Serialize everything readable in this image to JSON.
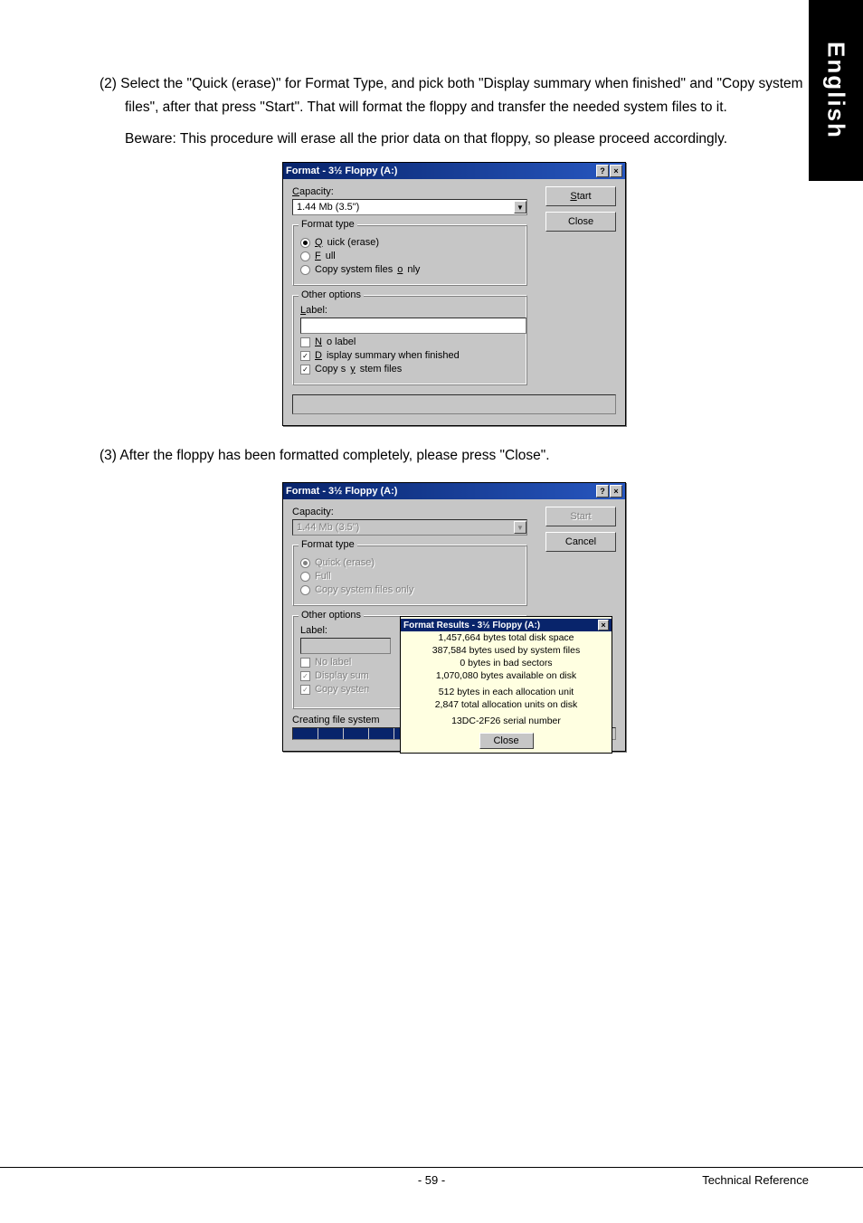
{
  "side_tab": "English",
  "step2": "(2)  Select the \"Quick (erase)\" for Format Type, and pick both \"Display summary when finished\" and \"Copy system files\", after that press \"Start\".  That will format the floppy and transfer the needed system files to it.",
  "step2_note": "Beware: This procedure will erase all the prior data on that floppy, so please proceed accordingly.",
  "step3": "(3)  After the floppy has been formatted completely, please press \"Close\".",
  "dlg1": {
    "title": "Format - 3½ Floppy (A:)",
    "capacity_lbl": "Capacity:",
    "capacity_val": "1.44 Mb (3.5\")",
    "start": "Start",
    "close": "Close",
    "ftype_legend": "Format type",
    "r1": "Quick (erase)",
    "r2": "Full",
    "r3": "Copy system files only",
    "other_legend": "Other options",
    "label_lbl": "Label:",
    "c1": "No label",
    "c2": "Display summary when finished",
    "c3": "Copy system files"
  },
  "dlg2": {
    "title": "Format - 3½ Floppy (A:)",
    "capacity_lbl": "Capacity:",
    "capacity_val": "1.44 Mb (3.5\")",
    "start": "Start",
    "cancel": "Cancel",
    "ftype_legend": "Format type",
    "r1": "Quick (erase)",
    "r2": "Full",
    "r3": "Copy system files only",
    "other_legend": "Other options",
    "label_lbl": "Label:",
    "c1": "No label",
    "c2": "Display summary when finished",
    "c3": "Copy system files",
    "progress_lbl": "Creating file system",
    "res_title": "Format Results - 3½ Floppy (A:)",
    "res_l1": "1,457,664 bytes total disk space",
    "res_l2": "387,584 bytes used by system files",
    "res_l3": "0 bytes in bad sectors",
    "res_l4": "1,070,080 bytes available on disk",
    "res_l5": "512 bytes in each allocation unit",
    "res_l6": "2,847 total allocation units on disk",
    "res_l7": "13DC-2F26 serial number",
    "res_close": "Close"
  },
  "footer": {
    "page": "- 59 -",
    "ref": "Technical Reference"
  }
}
